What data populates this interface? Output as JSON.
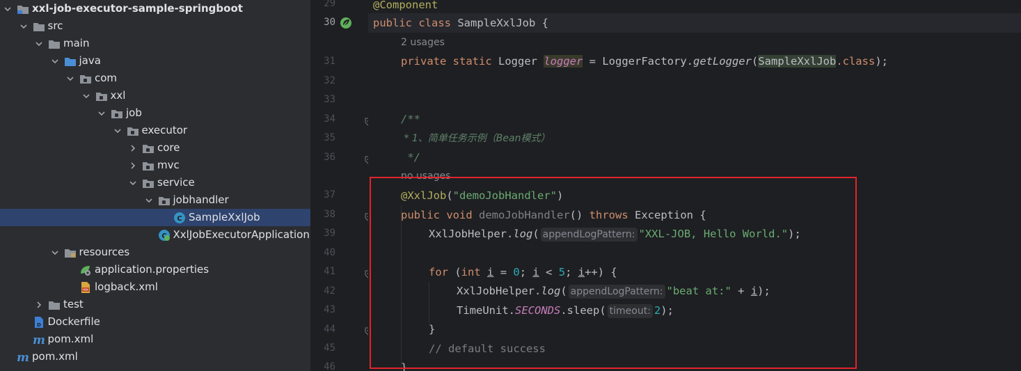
{
  "project_tree": {
    "items": [
      {
        "label": "xxl-job-executor-sample-springboot",
        "icon": "module-folder-icon",
        "expanded": true,
        "bold": true
      },
      {
        "label": "src",
        "icon": "folder-icon",
        "expanded": true
      },
      {
        "label": "main",
        "icon": "folder-icon",
        "expanded": true
      },
      {
        "label": "java",
        "icon": "source-folder-icon",
        "expanded": true
      },
      {
        "label": "com",
        "icon": "package-icon",
        "expanded": true
      },
      {
        "label": "xxl",
        "icon": "package-icon",
        "expanded": true
      },
      {
        "label": "job",
        "icon": "package-icon",
        "expanded": true
      },
      {
        "label": "executor",
        "icon": "package-icon",
        "expanded": true
      },
      {
        "label": "core",
        "icon": "package-icon",
        "expanded": false
      },
      {
        "label": "mvc",
        "icon": "package-icon",
        "expanded": false
      },
      {
        "label": "service",
        "icon": "package-icon",
        "expanded": true
      },
      {
        "label": "jobhandler",
        "icon": "package-icon",
        "expanded": true
      },
      {
        "label": "SampleXxlJob",
        "icon": "class-icon",
        "selected": true
      },
      {
        "label": "XxlJobExecutorApplication",
        "icon": "spring-boot-class-icon"
      },
      {
        "label": "resources",
        "icon": "resources-folder-icon",
        "expanded": true
      },
      {
        "label": "application.properties",
        "icon": "spring-properties-icon"
      },
      {
        "label": "logback.xml",
        "icon": "xml-file-icon"
      },
      {
        "label": "test",
        "icon": "folder-icon",
        "expanded": false
      },
      {
        "label": "Dockerfile",
        "icon": "docker-file-icon"
      },
      {
        "label": "pom.xml",
        "icon": "maven-icon"
      },
      {
        "label": "pom.xml",
        "icon": "maven-icon"
      }
    ]
  },
  "gutter": {
    "line_numbers": [
      "29",
      "30",
      "31",
      "32",
      "33",
      "34",
      "35",
      "36",
      "37",
      "38",
      "39",
      "40",
      "41",
      "42",
      "43",
      "44",
      "45",
      "46"
    ],
    "current_line": "30"
  },
  "editor": {
    "annotation_component": "@Component",
    "class_kw": "public class",
    "class_name": "SampleXxlJob",
    "brace_open": " {",
    "usages_hint": "2 usages",
    "logger_kw": "private static",
    "logger_type": "Logger",
    "logger_field": "logger",
    "logger_eq": " = LoggerFactory.",
    "get_logger": "getLogger",
    "logger_arg_class": "SampleXxlJob",
    "logger_tail": ".class",
    "logger_end": ");",
    "doc_open": "/**",
    "doc_body": " * 1、简单任务示例（Bean模式）",
    "doc_close": " */",
    "no_usages_hint": "no usages",
    "xxljob_ann": "@XxlJob",
    "xxljob_arg": "\"demoJobHandler\"",
    "method_kw": "public void",
    "method_name": "demoJobHandler",
    "method_throws": "throws",
    "method_exception": "Exception {",
    "helper_class": "XxlJobHelper.",
    "log_method": "log",
    "hint_append": "appendLogPattern:",
    "hello_string": "\"XXL-JOB, Hello World.\"",
    "for_kw": "for",
    "int_kw": "int",
    "loop_var": "i",
    "loop_zero": "0",
    "loop_five": "5",
    "beat_string": "\"beat at:\"",
    "timeunit": "TimeUnit.",
    "seconds": "SECONDS",
    "sleep": ".sleep(",
    "hint_timeout": "timeout:",
    "sleep_value": "2",
    "close_brace": "}",
    "comment_default": "// default success"
  }
}
